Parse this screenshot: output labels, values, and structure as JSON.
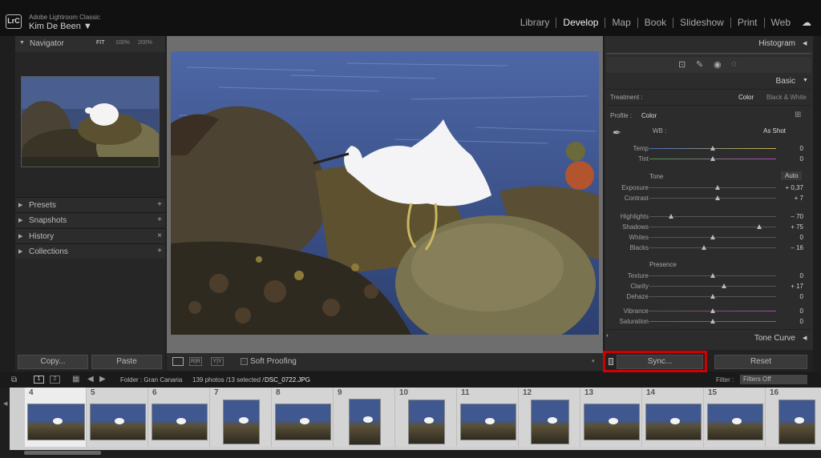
{
  "app": {
    "name": "Adobe Lightroom Classic",
    "user": "Kim De Been",
    "logo": "LrC"
  },
  "modules": [
    {
      "label": "Library",
      "active": false
    },
    {
      "label": "Develop",
      "active": true
    },
    {
      "label": "Map",
      "active": false
    },
    {
      "label": "Book",
      "active": false
    },
    {
      "label": "Slideshow",
      "active": false
    },
    {
      "label": "Print",
      "active": false
    },
    {
      "label": "Web",
      "active": false
    }
  ],
  "navigator": {
    "title": "Navigator",
    "zoom": [
      "FIT",
      "100%",
      "200%"
    ]
  },
  "left_sections": [
    {
      "label": "Presets",
      "action": "+"
    },
    {
      "label": "Snapshots",
      "action": "+"
    },
    {
      "label": "History",
      "action": "×"
    },
    {
      "label": "Collections",
      "action": "+"
    }
  ],
  "left_buttons": {
    "copy": "Copy...",
    "paste": "Paste"
  },
  "toolbar": {
    "soft_proofing": "Soft Proofing"
  },
  "right": {
    "histogram": "Histogram",
    "basic": "Basic",
    "treatment_label": "Treatment :",
    "treatment_color": "Color",
    "treatment_bw": "Black & White",
    "profile_label": "Profile :",
    "profile_value": "Color",
    "wb_label": "WB :",
    "wb_value": "As Shot",
    "tone": "Tone",
    "auto": "Auto",
    "presence": "Presence",
    "tone_curve": "Tone Curve",
    "sync": "Sync...",
    "reset": "Reset"
  },
  "sliders": [
    {
      "label": "Temp",
      "value": "0",
      "pos": 0.5
    },
    {
      "label": "Tint",
      "value": "0",
      "pos": 0.5
    },
    {
      "label": "Exposure",
      "value": "+ 0,37",
      "pos": 0.54
    },
    {
      "label": "Contrast",
      "value": "+ 7",
      "pos": 0.54
    },
    {
      "label": "Highlights",
      "value": "– 70",
      "pos": 0.17
    },
    {
      "label": "Shadows",
      "value": "+ 75",
      "pos": 0.87
    },
    {
      "label": "Whites",
      "value": "0",
      "pos": 0.5
    },
    {
      "label": "Blacks",
      "value": "– 16",
      "pos": 0.43
    },
    {
      "label": "Texture",
      "value": "0",
      "pos": 0.5
    },
    {
      "label": "Clarity",
      "value": "+ 17",
      "pos": 0.59
    },
    {
      "label": "Dehaze",
      "value": "0",
      "pos": 0.5
    },
    {
      "label": "Vibrance",
      "value": "0",
      "pos": 0.5
    },
    {
      "label": "Saturation",
      "value": "0",
      "pos": 0.5
    }
  ],
  "filmbar": {
    "folder": "Folder : Gran Canaria",
    "count": "139 photos /13 selected /",
    "file": "DSC_0722.JPG",
    "filter_label": "Filter :",
    "filter_value": "Filters Off"
  },
  "film_numbers": [
    "4",
    "5",
    "6",
    "7",
    "8",
    "9",
    "10",
    "11",
    "12",
    "13",
    "14",
    "15",
    "16"
  ]
}
